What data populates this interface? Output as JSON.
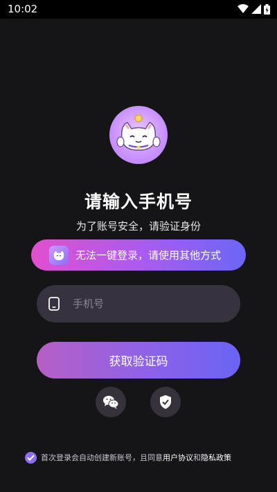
{
  "status_bar": {
    "time": "10:02"
  },
  "login": {
    "title": "请输入手机号",
    "subtitle": "为了账号安全，请验证身份",
    "notice": "无法一键登录，请使用其他方式",
    "phone_placeholder": "手机号",
    "get_code_label": "获取验证码"
  },
  "agreement": {
    "prefix": "首次登录会自动创建新账号，且同意",
    "user_agreement": "用户协议",
    "and": "和",
    "privacy_policy": "隐私政策",
    "checked": true
  },
  "colors": {
    "background": "#151417",
    "accent_start": "#e24fd0",
    "accent_end": "#6b66f6",
    "field_bg": "#36333f"
  },
  "icons": [
    "wifi-icon",
    "signal-icon",
    "battery-icon",
    "cat-avatar-icon",
    "phone-icon",
    "wechat-icon",
    "shield-icon",
    "check-icon"
  ]
}
